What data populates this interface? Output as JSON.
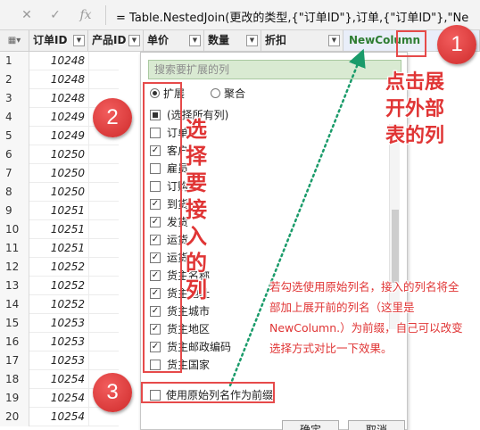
{
  "formula_bar": {
    "cancel_icon": "x-icon",
    "confirm_icon": "check-icon",
    "fx_label": "fx",
    "formula": "= Table.NestedJoin(更改的类型,{\"订单ID\"},订单,{\"订单ID\"},\"Ne"
  },
  "grid": {
    "corner_label": "▦▾",
    "columns": [
      "订单ID",
      "产品ID",
      "单价",
      "数量",
      "折扣",
      "NewColumn"
    ],
    "expand_icon": "expand-columns-icon",
    "rows": [
      {
        "n": "1",
        "id": "10248"
      },
      {
        "n": "2",
        "id": "10248"
      },
      {
        "n": "3",
        "id": "10248"
      },
      {
        "n": "4",
        "id": "10249"
      },
      {
        "n": "5",
        "id": "10249"
      },
      {
        "n": "6",
        "id": "10250"
      },
      {
        "n": "7",
        "id": "10250"
      },
      {
        "n": "8",
        "id": "10250"
      },
      {
        "n": "9",
        "id": "10251"
      },
      {
        "n": "10",
        "id": "10251"
      },
      {
        "n": "11",
        "id": "10251"
      },
      {
        "n": "12",
        "id": "10252"
      },
      {
        "n": "13",
        "id": "10252"
      },
      {
        "n": "14",
        "id": "10252"
      },
      {
        "n": "15",
        "id": "10253"
      },
      {
        "n": "16",
        "id": "10253"
      },
      {
        "n": "17",
        "id": "10253"
      },
      {
        "n": "18",
        "id": "10254"
      },
      {
        "n": "19",
        "id": "10254"
      },
      {
        "n": "20",
        "id": "10254"
      }
    ]
  },
  "popup": {
    "search_placeholder": "搜索要扩展的列",
    "radio_expand": "扩展",
    "radio_aggregate": "聚合",
    "items": [
      {
        "label": "(选择所有列)",
        "state": "indeterminate"
      },
      {
        "label": "订单",
        "state": "unchecked"
      },
      {
        "label": "客户",
        "state": "checked"
      },
      {
        "label": "雇员",
        "state": "unchecked"
      },
      {
        "label": "订购",
        "state": "unchecked"
      },
      {
        "label": "到货",
        "state": "checked"
      },
      {
        "label": "发货",
        "state": "checked"
      },
      {
        "label": "运货",
        "state": "checked"
      },
      {
        "label": "运货",
        "state": "checked"
      },
      {
        "label": "货主名称",
        "state": "checked"
      },
      {
        "label": "货主地址",
        "state": "checked"
      },
      {
        "label": "货主城市",
        "state": "checked"
      },
      {
        "label": "货主地区",
        "state": "checked"
      },
      {
        "label": "货主邮政编码",
        "state": "checked"
      },
      {
        "label": "货主国家",
        "state": "unchecked"
      }
    ],
    "prefix_label": "使用原始列名作为前缀",
    "ok_label": "确定",
    "cancel_label": "取消"
  },
  "annotations": {
    "badge1": "1",
    "badge2": "2",
    "badge3": "3",
    "callout1": "点击展开外部表的列",
    "callout2": "选择要接入的列",
    "note": "若勾选使用原始列名，接入的列名将全部加上展开前的列名（这里是NewColumn.）为前缀，自己可以改变选择方式对比一下效果。",
    "accent_color": "#e64a4a",
    "arrow_color": "#1a9b6a"
  }
}
